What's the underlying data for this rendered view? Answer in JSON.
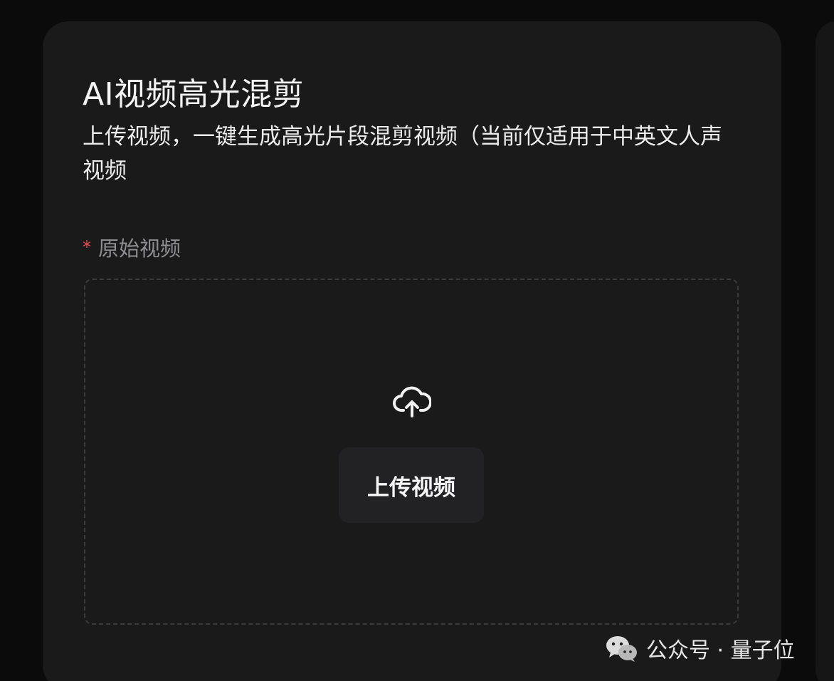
{
  "card": {
    "title": "AI视频高光混剪",
    "subtitle": "上传视频，一键生成高光片段混剪视频（当前仅适用于中英文人声视频",
    "field": {
      "required_mark": "*",
      "label": "原始视频"
    },
    "upload": {
      "icon": "cloud-upload-icon",
      "button_label": "上传视频"
    }
  },
  "watermark": {
    "icon": "wechat-icon",
    "text": "公众号 · 量子位"
  },
  "colors": {
    "background": "#0b0b0c",
    "card": "#1a1a1b",
    "required": "#e8484c",
    "button": "#222224"
  }
}
